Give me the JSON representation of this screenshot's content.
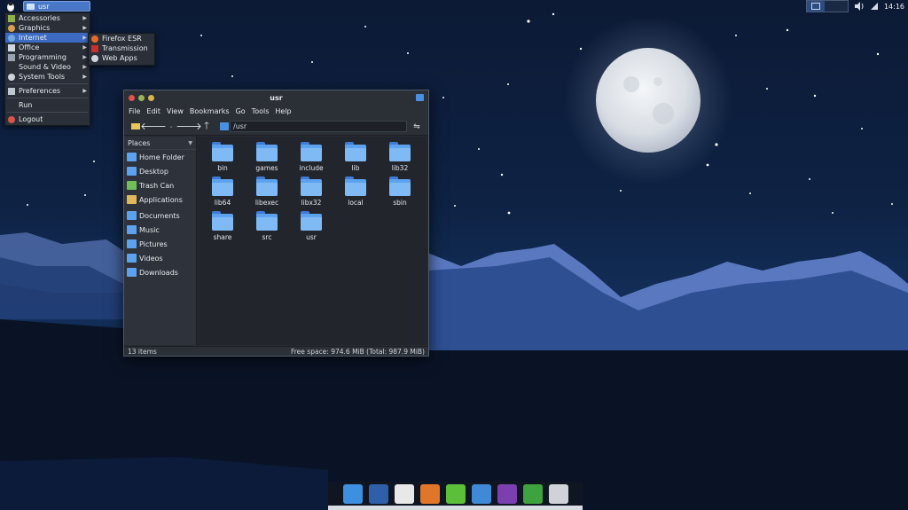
{
  "panel": {
    "task_label": "usr",
    "clock": "14:16"
  },
  "app_menu": {
    "items": [
      {
        "label": "Accessories",
        "icon": "accessories-icon",
        "submenu": true
      },
      {
        "label": "Graphics",
        "icon": "graphics-icon",
        "submenu": true
      },
      {
        "label": "Internet",
        "icon": "globe-icon",
        "submenu": true,
        "active": true
      },
      {
        "label": "Office",
        "icon": "office-icon",
        "submenu": true
      },
      {
        "label": "Programming",
        "icon": "programming-icon",
        "submenu": true
      },
      {
        "label": "Sound & Video",
        "icon": "media-icon",
        "submenu": true
      },
      {
        "label": "System Tools",
        "icon": "gear-icon",
        "submenu": true
      },
      {
        "label": "Preferences",
        "icon": "preferences-icon",
        "submenu": true
      },
      {
        "label": "Run",
        "icon": "",
        "submenu": false
      },
      {
        "label": "Logout",
        "icon": "logout-icon",
        "submenu": false
      }
    ]
  },
  "internet_submenu": {
    "items": [
      {
        "label": "Firefox ESR",
        "icon": "firefox-icon"
      },
      {
        "label": "Transmission",
        "icon": "transmission-icon"
      },
      {
        "label": "Web Apps",
        "icon": "web-apps-icon"
      }
    ]
  },
  "file_manager": {
    "title": "usr",
    "menubar": [
      "File",
      "Edit",
      "View",
      "Bookmarks",
      "Go",
      "Tools",
      "Help"
    ],
    "path": "/usr",
    "sidebar": {
      "header": "Places",
      "items": [
        {
          "label": "Home Folder",
          "icon": "home-folder-icon"
        },
        {
          "label": "Desktop",
          "icon": "desktop-icon"
        },
        {
          "label": "Trash Can",
          "icon": "trash-icon"
        },
        {
          "label": "Applications",
          "icon": "applications-icon"
        },
        {
          "label": "Documents",
          "icon": "documents-icon"
        },
        {
          "label": "Music",
          "icon": "music-icon"
        },
        {
          "label": "Pictures",
          "icon": "pictures-icon"
        },
        {
          "label": "Videos",
          "icon": "videos-icon"
        },
        {
          "label": "Downloads",
          "icon": "downloads-icon"
        }
      ]
    },
    "folders": [
      "bin",
      "games",
      "include",
      "lib",
      "lib32",
      "lib64",
      "libexec",
      "libx32",
      "local",
      "sbin",
      "share",
      "src",
      "usr"
    ],
    "status_left": "13 items",
    "status_right": "Free space: 974.6 MiB (Total: 987.9 MiB)"
  },
  "dock": {
    "items": [
      {
        "name": "file-manager-icon",
        "color": "#3d8fe0"
      },
      {
        "name": "calculator-icon",
        "color": "#2e5fa8"
      },
      {
        "name": "software-manager-icon",
        "color": "#e8e8e8"
      },
      {
        "name": "presentation-icon",
        "color": "#e0762a"
      },
      {
        "name": "leaf-icon",
        "color": "#5bbf3a"
      },
      {
        "name": "writer-icon",
        "color": "#3f89d6"
      },
      {
        "name": "media-player-icon",
        "color": "#7b3fb0"
      },
      {
        "name": "spreadsheet-icon",
        "color": "#3ea33e"
      },
      {
        "name": "archive-icon",
        "color": "#cfd3d8"
      }
    ]
  },
  "colors": {
    "accent": "#3d6bc4",
    "folder": "#5ca2ee"
  }
}
